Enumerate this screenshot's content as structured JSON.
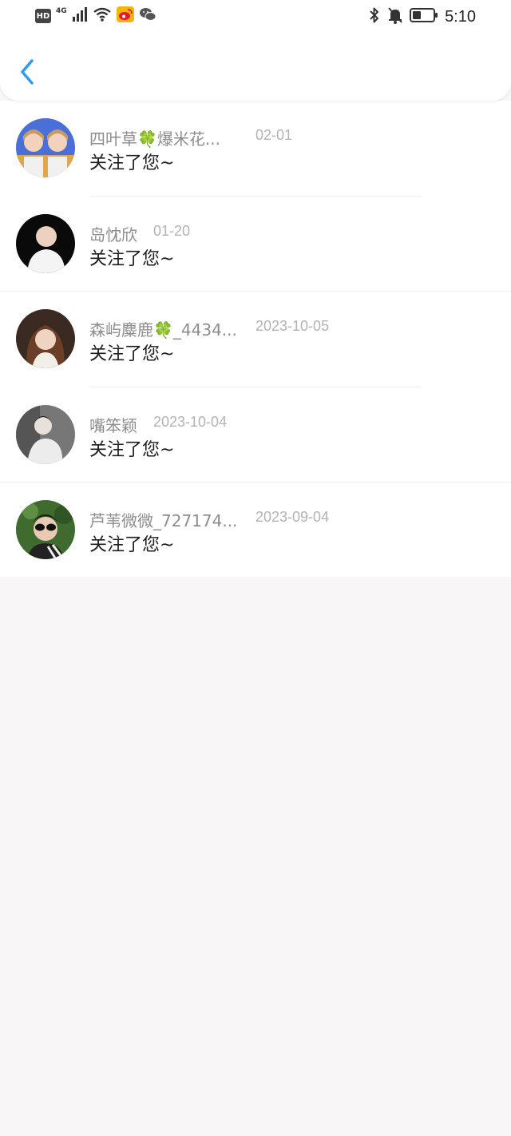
{
  "status_bar": {
    "hd_label": "HD",
    "network_label": "4G",
    "time": "5:10",
    "icons": [
      "signal-icon",
      "wifi-icon",
      "weibo-icon",
      "wechat-icon",
      "bluetooth-icon",
      "bell-muted-icon",
      "battery-icon"
    ]
  },
  "header": {
    "back_icon": "chevron-left-icon",
    "accent_color": "#2f9ee6"
  },
  "notifications": [
    {
      "name": "四叶草🍀爆米花...",
      "time": "02-01",
      "message": "关注了您~"
    },
    {
      "name": "岛忱欣",
      "time": "01-20",
      "message": "关注了您~"
    },
    {
      "name": "森屿麋鹿🍀_4434...",
      "time": "2023-10-05",
      "message": "关注了您~"
    },
    {
      "name": "嘴笨颖",
      "time": "2023-10-04",
      "message": "关注了您~"
    },
    {
      "name": "芦苇微微_727174...",
      "time": "2023-09-04",
      "message": "关注了您~"
    }
  ]
}
